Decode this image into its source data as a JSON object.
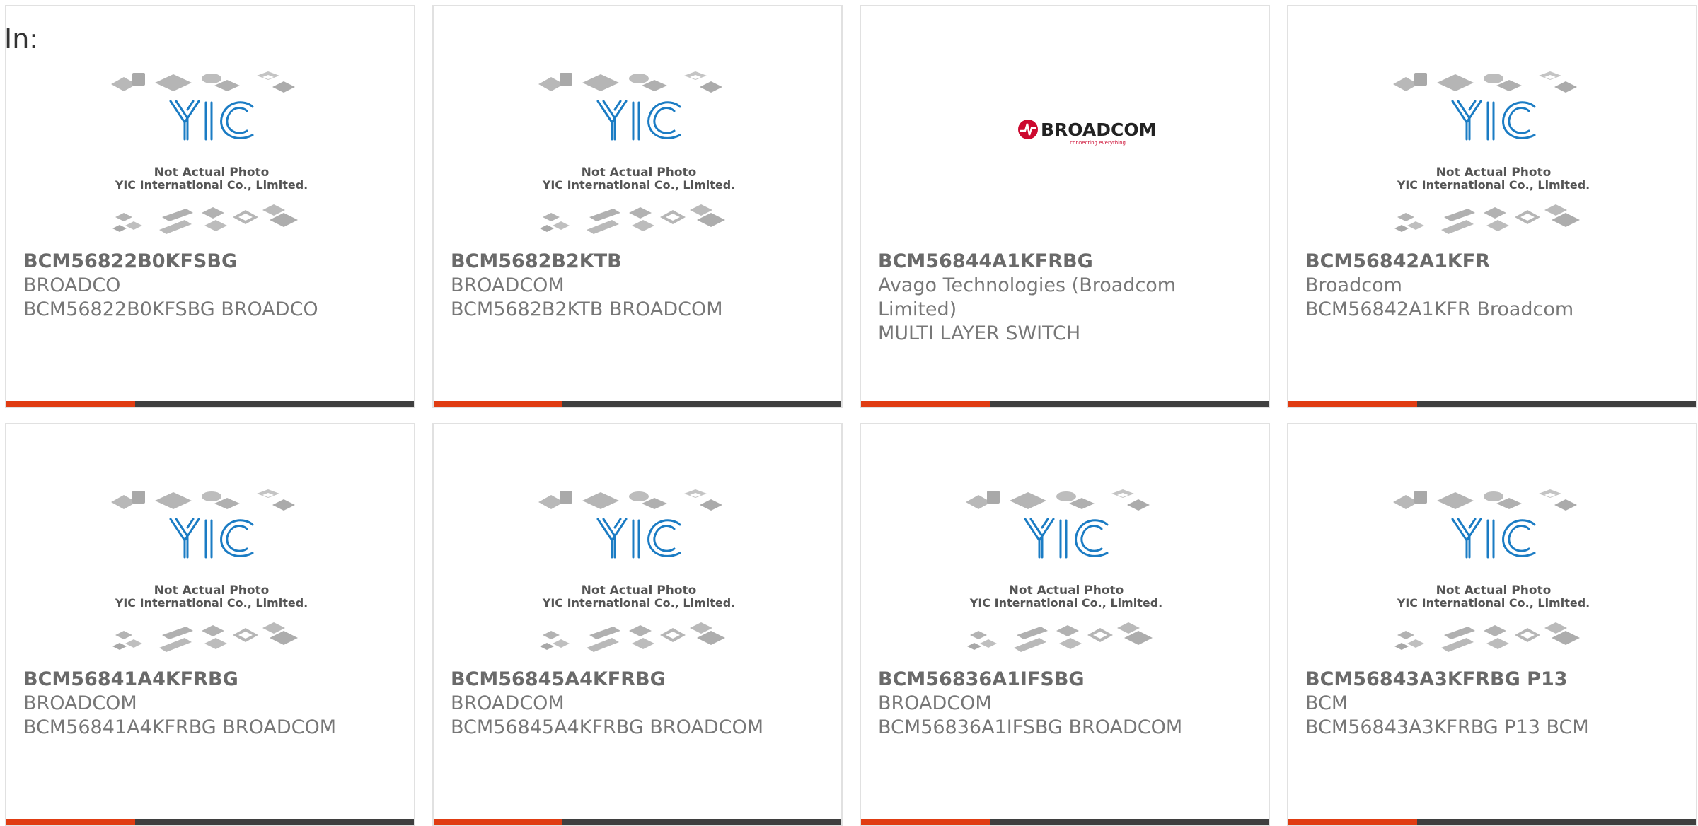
{
  "header": {
    "label": "In:"
  },
  "placeholder": {
    "line1": "Not Actual Photo",
    "line2": "YIC International Co., Limited.",
    "logo_text": "YIC"
  },
  "broadcom_logo": {
    "text": "BROADCOM",
    "tagline": "connecting everything"
  },
  "colors": {
    "accent": "#e03c12",
    "bar": "#3f3f3f",
    "border": "#e1e1e1",
    "logo_blue": "#1b7cc4",
    "broadcom_red": "#cc092f"
  },
  "products": [
    {
      "part_number": "BCM56822B0KFSBG",
      "manufacturer": "BROADCO",
      "description": "BCM56822B0KFSBG BROADCO",
      "image": "placeholder"
    },
    {
      "part_number": "BCM5682B2KTB",
      "manufacturer": "BROADCOM",
      "description": "BCM5682B2KTB BROADCOM",
      "image": "placeholder"
    },
    {
      "part_number": "BCM56844A1KFRBG",
      "manufacturer": "Avago Technologies (Broadcom Limited)",
      "description": "MULTI LAYER SWITCH",
      "image": "broadcom-logo"
    },
    {
      "part_number": "BCM56842A1KFR",
      "manufacturer": "Broadcom",
      "description": "BCM56842A1KFR Broadcom",
      "image": "placeholder"
    },
    {
      "part_number": "BCM56841A4KFRBG",
      "manufacturer": "BROADCOM",
      "description": "BCM56841A4KFRBG BROADCOM",
      "image": "placeholder"
    },
    {
      "part_number": "BCM56845A4KFRBG",
      "manufacturer": "BROADCOM",
      "description": "BCM56845A4KFRBG BROADCOM",
      "image": "placeholder"
    },
    {
      "part_number": "BCM56836A1IFSBG",
      "manufacturer": "BROADCOM",
      "description": "BCM56836A1IFSBG BROADCOM",
      "image": "placeholder"
    },
    {
      "part_number": "BCM56843A3KFRBG P13",
      "manufacturer": "BCM",
      "description": "BCM56843A3KFRBG P13 BCM",
      "image": "placeholder"
    }
  ]
}
